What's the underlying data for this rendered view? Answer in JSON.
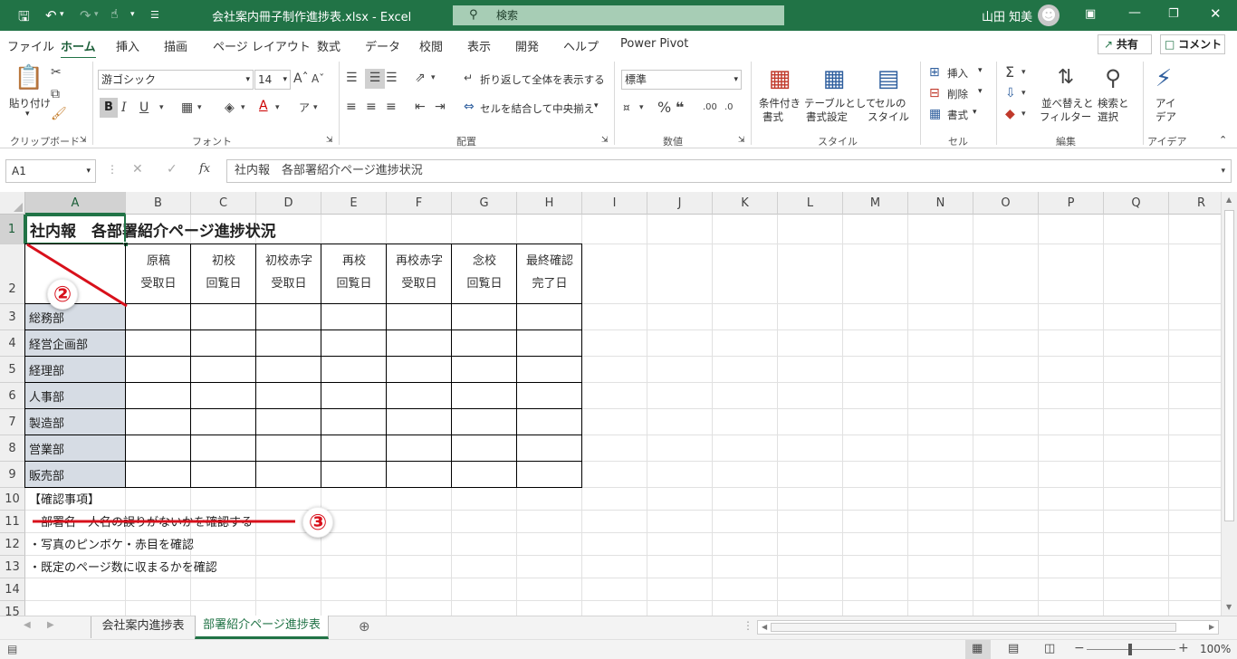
{
  "window": {
    "title": "会社案内冊子制作進捗表.xlsx  -  Excel",
    "search_placeholder": "検索",
    "user_name": "山田 知美"
  },
  "tabs": [
    "ファイル",
    "ホーム",
    "挿入",
    "描画",
    "ページ レイアウト",
    "数式",
    "データ",
    "校閲",
    "表示",
    "開発",
    "ヘルプ",
    "Power Pivot"
  ],
  "share_label": "共有",
  "comment_label": "コメント",
  "ribbon": {
    "paste_label": "貼り付け",
    "font_name": "游ゴシック",
    "font_size": "14",
    "wrap_text": "折り返して全体を表示する",
    "merge_center": "セルを結合して中央揃え",
    "number_format": "標準",
    "cond_format": [
      "条件付き",
      "書式"
    ],
    "table_format": [
      "テーブルとして",
      "書式設定"
    ],
    "cell_style": [
      "セルの",
      "スタイル"
    ],
    "insert": "挿入",
    "delete": "削除",
    "format": "書式",
    "sort_filter": [
      "並べ替えと",
      "フィルター"
    ],
    "find_select": [
      "検索と",
      "選択"
    ],
    "ideas": [
      "アイ",
      "デア"
    ],
    "groups": [
      "クリップボード",
      "フォント",
      "配置",
      "数値",
      "スタイル",
      "セル",
      "編集",
      "アイデア"
    ],
    "bold_label": "B",
    "italic_label": "I",
    "underline_label": "U"
  },
  "formula_bar": {
    "name_box": "A1",
    "formula": "社内報　各部署紹介ページ進捗状況"
  },
  "columns": [
    "A",
    "B",
    "C",
    "D",
    "E",
    "F",
    "G",
    "H",
    "I",
    "J",
    "K",
    "L",
    "M",
    "N",
    "O",
    "P",
    "Q",
    "R"
  ],
  "rows": [
    "1",
    "2",
    "3",
    "4",
    "5",
    "6",
    "7",
    "8",
    "9",
    "10",
    "11",
    "12",
    "13",
    "14",
    "15"
  ],
  "sheet": {
    "title": "社内報　各部署紹介ページ進捗状況",
    "headers": [
      [
        "原稿",
        "受取日"
      ],
      [
        "初校",
        "回覧日"
      ],
      [
        "初校赤字",
        "受取日"
      ],
      [
        "再校",
        "回覧日"
      ],
      [
        "再校赤字",
        "受取日"
      ],
      [
        "念校",
        "回覧日"
      ],
      [
        "最終確認",
        "完了日"
      ]
    ],
    "departments": [
      "総務部",
      "経営企画部",
      "経理部",
      "人事部",
      "製造部",
      "営業部",
      "販売部"
    ],
    "notes": [
      "【確認事項】",
      "・部署名・人名の誤りがないかを確認する",
      "・写真のピンボケ・赤目を確認",
      "・既定のページ数に収まるかを確認"
    ]
  },
  "annotations": [
    "②",
    "③"
  ],
  "sheet_tabs": [
    "会社案内進捗表",
    "部署紹介ページ進捗表"
  ],
  "status": {
    "zoom": "100%"
  },
  "colors": {
    "excel_green": "#217346",
    "annotation_red": "#d8101b",
    "dept_fill": "#d6dce4"
  }
}
